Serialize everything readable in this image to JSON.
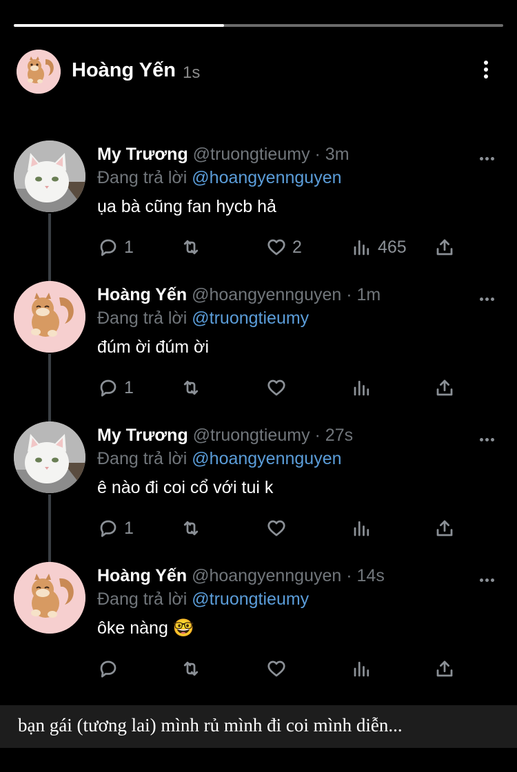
{
  "story": {
    "progress": 0.43,
    "author_name": "Hoàng Yến",
    "time_ago": "1s",
    "caption": "bạn gái (tương lai) mình rủ mình đi coi mình diễn..."
  },
  "tweets": [
    {
      "avatar": "cat-avatar",
      "name": "My Trương",
      "handle": "@truongtieumy",
      "sep": " · ",
      "time": "3m",
      "reply_prefix": "Đang trả lời ",
      "reply_to": "@hoangyennguyen",
      "text": "ụa bà cũng fan hycb hả",
      "replies": "1",
      "retweets": "",
      "likes": "2",
      "views": "465"
    },
    {
      "avatar": "squirrel-avatar",
      "name": "Hoàng Yến",
      "handle": "@hoangyennguyen",
      "sep": " · ",
      "time": "1m",
      "reply_prefix": "Đang trả lời ",
      "reply_to": "@truongtieumy",
      "text": "đúm ời đúm ời",
      "replies": "1",
      "retweets": "",
      "likes": "",
      "views": ""
    },
    {
      "avatar": "cat-avatar",
      "name": "My Trương",
      "handle": "@truongtieumy",
      "sep": " · ",
      "time": "27s",
      "reply_prefix": "Đang trả lời ",
      "reply_to": "@hoangyennguyen",
      "text": "ê nào đi coi cổ với tui k",
      "replies": "1",
      "retweets": "",
      "likes": "",
      "views": ""
    },
    {
      "avatar": "squirrel-avatar",
      "name": "Hoàng Yến",
      "handle": "@hoangyennguyen",
      "sep": " · ",
      "time": "14s",
      "reply_prefix": "Đang trả lời ",
      "reply_to": "@truongtieumy",
      "text": "ôke nàng 🤓",
      "replies": "",
      "retweets": "",
      "likes": "",
      "views": ""
    }
  ],
  "icons": {
    "reply": "reply-icon",
    "retweet": "retweet-icon",
    "like": "heart-icon",
    "views": "views-icon",
    "share": "share-icon",
    "more": "more-icon"
  },
  "colors": {
    "background": "#000000",
    "mention": "#5b9dd9",
    "muted": "#71767b",
    "thread_line": "#3a3f44"
  }
}
